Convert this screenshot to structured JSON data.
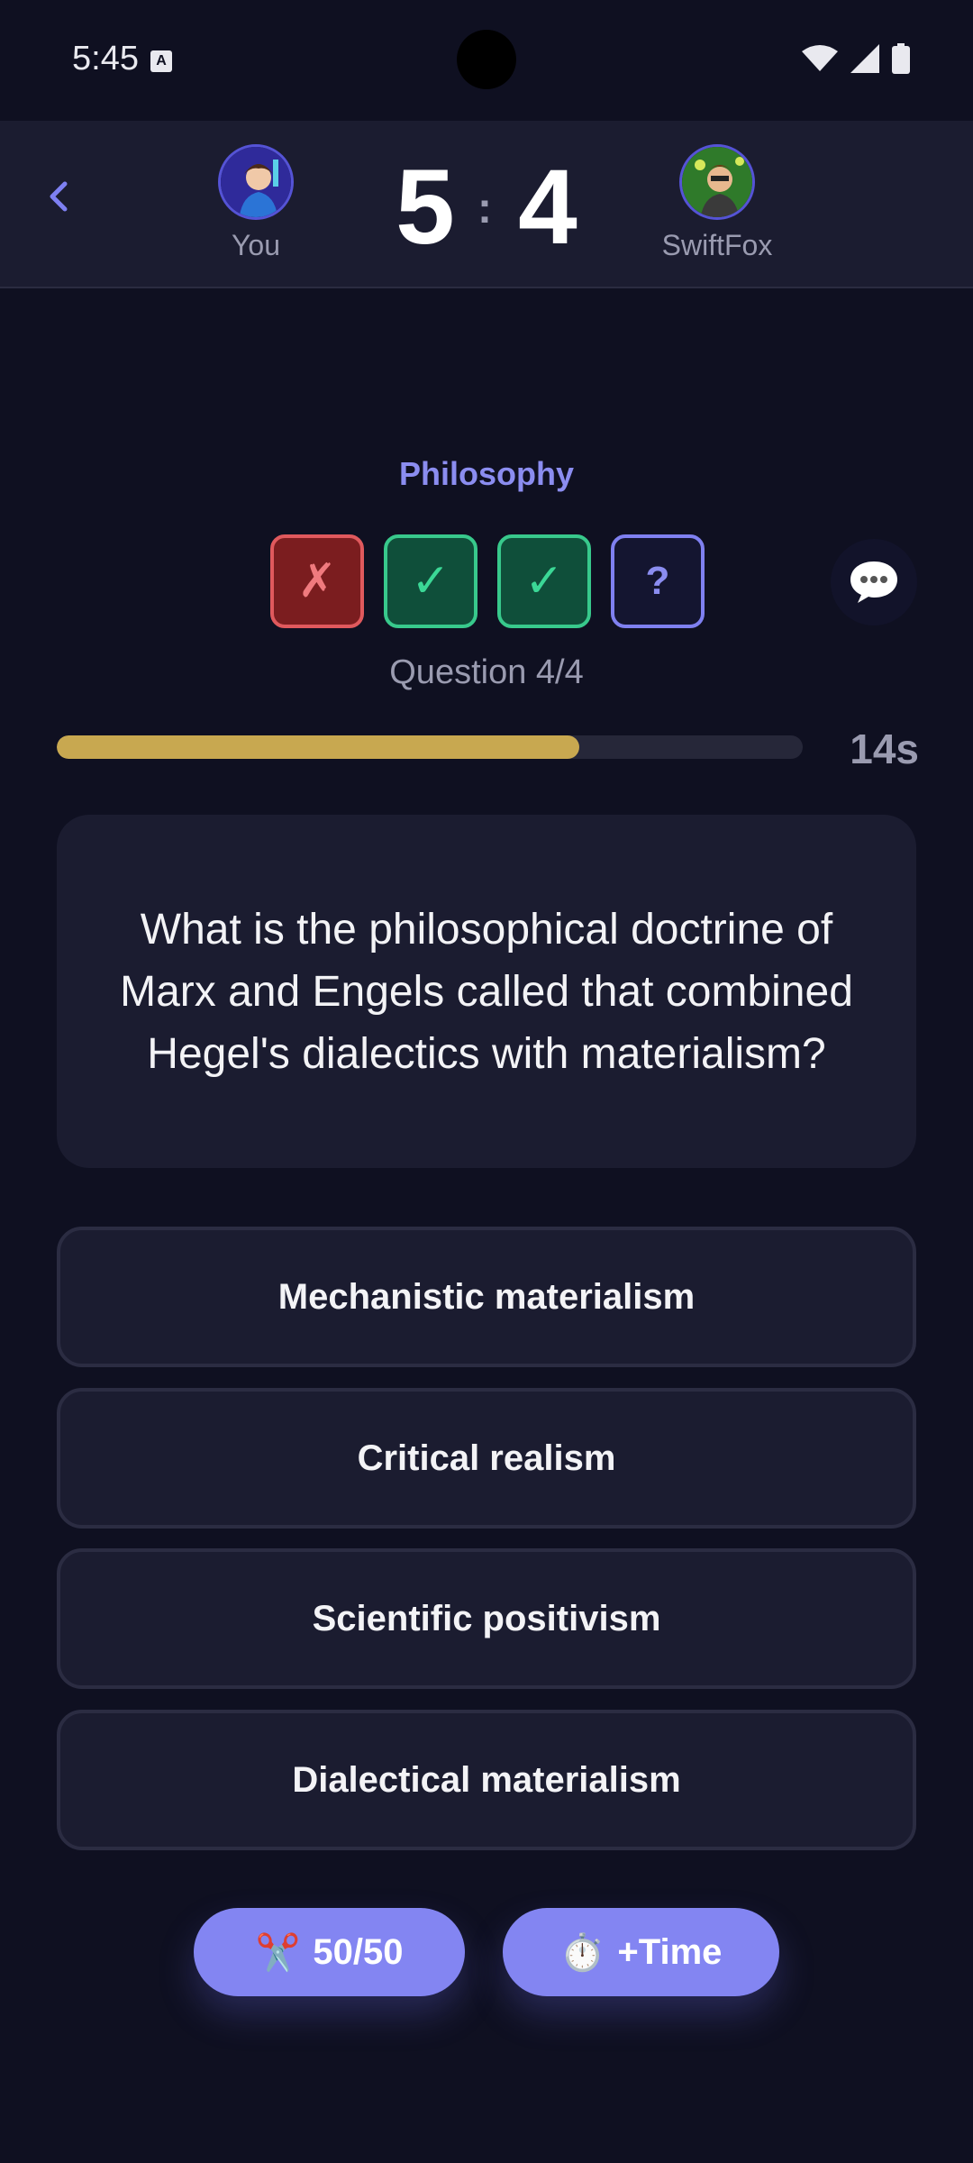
{
  "status_bar": {
    "time": "5:45",
    "notif_letter": "A"
  },
  "header": {
    "you": {
      "name": "You"
    },
    "opponent": {
      "name": "SwiftFox"
    },
    "score_you": "5",
    "score_separator": ":",
    "score_opponent": "4"
  },
  "quiz": {
    "category": "Philosophy",
    "rounds": [
      {
        "state": "wrong",
        "symbol": "✗"
      },
      {
        "state": "correct",
        "symbol": "✓"
      },
      {
        "state": "correct",
        "symbol": "✓"
      },
      {
        "state": "pending",
        "symbol": "?"
      }
    ],
    "question_count": "Question 4/4",
    "timer_fraction": 0.7,
    "timer_text": "14s",
    "question": "What is the philosophical doctrine of Marx and Engels called that combined Hegel's dialectics with materialism?",
    "answers": [
      "Mechanistic materialism",
      "Critical realism",
      "Scientific positivism",
      "Dialectical materialism"
    ]
  },
  "lifelines": {
    "fifty_icon": "✂️",
    "fifty_label": "50/50",
    "time_icon": "⏱️",
    "time_label": "+Time"
  },
  "colors": {
    "background": "#0f1021",
    "accent": "#8385f2",
    "timer": "#c8a850",
    "wrong": "#e0595d",
    "correct": "#38c98c"
  }
}
